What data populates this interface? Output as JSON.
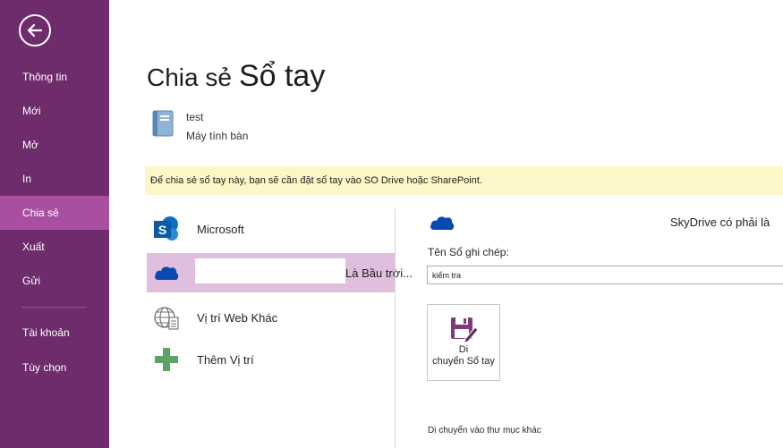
{
  "sidebar": {
    "items": [
      {
        "id": "info",
        "label": "Thông tin"
      },
      {
        "id": "new",
        "label": "Mới"
      },
      {
        "id": "open",
        "label": "Mở"
      },
      {
        "id": "print",
        "label": "In"
      },
      {
        "id": "share",
        "label": "Chia sẻ",
        "active": true
      },
      {
        "id": "export",
        "label": "Xuất"
      },
      {
        "id": "send",
        "label": "Gửi"
      }
    ],
    "bottom_items": [
      {
        "id": "account",
        "label": "Tài khoản"
      },
      {
        "id": "options",
        "label": "Tùy chọn"
      }
    ]
  },
  "page": {
    "title_part1": "Chia sẻ",
    "title_part2": "Sổ tay"
  },
  "notebook": {
    "name": "test",
    "location": "Máy tính bàn"
  },
  "banner": {
    "text": "Để chia sẻ sổ tay này, bạn sẽ cần đặt sổ tay vào SO Drive hoặc SharePoint."
  },
  "locations": [
    {
      "id": "microsoft",
      "label": "Microsoft"
    },
    {
      "id": "cloud",
      "overflow_label": "Là Bầu trời...",
      "selected": true
    },
    {
      "id": "other-web",
      "label": "Vị trí Web Khác"
    },
    {
      "id": "add",
      "label": "Thêm Vị trí"
    }
  ],
  "right_panel": {
    "heading": "SkyDrive có phải là",
    "notebook_name_label": "Tên Sổ ghi chép:",
    "notebook_name_value": "kiểm tra",
    "move_button_line1": "Di",
    "move_button_line2": "chuyển Sổ tay",
    "move_folder_link": "Di chuyển vào thư mục khác"
  },
  "colors": {
    "sidebar_bg": "#6e2c6c",
    "sidebar_active": "#a8509f",
    "selected_location": "#dfbfdd",
    "banner_bg": "#fcf6c8",
    "sharepoint_blue": "#0f6fc6",
    "onedrive_blue": "#094ab2",
    "add_green": "#5aa469",
    "floppy_purple": "#80397b"
  }
}
